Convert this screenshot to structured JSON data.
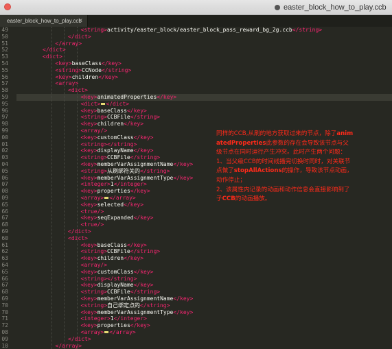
{
  "window": {
    "title": "easter_block_how_to_play.ccb",
    "document_icon": "document-proxy-icon"
  },
  "tab": {
    "label": "easter_block_how_to_play.ccb",
    "close_glyph": "×"
  },
  "colors": {
    "background": "#272822",
    "tag": "#f92672",
    "text": "#f8f8f2",
    "annotation": "#ff2a1a"
  },
  "lines": [
    {
      "num": "49",
      "indent": 6,
      "segs": [
        [
          "tag",
          "<string>"
        ],
        [
          "txt",
          "activity/easter_block/easter_block_pass_reward_bg_2g.ccb"
        ],
        [
          "tag",
          "</string>"
        ]
      ]
    },
    {
      "num": "50",
      "indent": 5,
      "segs": [
        [
          "tag",
          "</dict>"
        ]
      ]
    },
    {
      "num": "51",
      "indent": 4,
      "segs": [
        [
          "tag",
          "</array>"
        ]
      ]
    },
    {
      "num": "52",
      "indent": 3,
      "segs": [
        [
          "tag",
          "</dict>"
        ]
      ]
    },
    {
      "num": "53",
      "indent": 3,
      "segs": [
        [
          "tag",
          "<dict>"
        ]
      ]
    },
    {
      "num": "54",
      "indent": 4,
      "segs": [
        [
          "tag",
          "<key>"
        ],
        [
          "txt",
          "baseClass"
        ],
        [
          "tag",
          "</key>"
        ]
      ]
    },
    {
      "num": "55",
      "indent": 4,
      "segs": [
        [
          "tag",
          "<string>"
        ],
        [
          "txt",
          "CCNode"
        ],
        [
          "tag",
          "</string>"
        ]
      ]
    },
    {
      "num": "56",
      "indent": 4,
      "segs": [
        [
          "tag",
          "<key>"
        ],
        [
          "txt",
          "children"
        ],
        [
          "tag",
          "</key>"
        ]
      ]
    },
    {
      "num": "57",
      "indent": 4,
      "segs": [
        [
          "tag",
          "<array>"
        ]
      ]
    },
    {
      "num": "58",
      "indent": 5,
      "segs": [
        [
          "tag",
          "<dict>"
        ]
      ]
    },
    {
      "num": "59",
      "indent": 6,
      "segs": [
        [
          "tag",
          "<key>"
        ],
        [
          "txt",
          "animatedProperties"
        ],
        [
          "tag",
          "</key>"
        ]
      ]
    },
    {
      "num": "95",
      "indent": 6,
      "segs": [
        [
          "tag",
          "<dict>"
        ],
        [
          "mark",
          ""
        ],
        [
          "tag",
          "</dict>"
        ]
      ]
    },
    {
      "num": "96",
      "indent": 6,
      "segs": [
        [
          "tag",
          "<key>"
        ],
        [
          "txt",
          "baseClass"
        ],
        [
          "tag",
          "</key>"
        ]
      ]
    },
    {
      "num": "97",
      "indent": 6,
      "segs": [
        [
          "tag",
          "<string>"
        ],
        [
          "txt",
          "CCBFile"
        ],
        [
          "tag",
          "</string>"
        ]
      ]
    },
    {
      "num": "98",
      "indent": 6,
      "segs": [
        [
          "tag",
          "<key>"
        ],
        [
          "txt",
          "children"
        ],
        [
          "tag",
          "</key>"
        ]
      ]
    },
    {
      "num": "99",
      "indent": 6,
      "segs": [
        [
          "tag",
          "<array/>"
        ]
      ]
    },
    {
      "num": "00",
      "indent": 6,
      "segs": [
        [
          "tag",
          "<key>"
        ],
        [
          "txt",
          "customClass"
        ],
        [
          "tag",
          "</key>"
        ]
      ]
    },
    {
      "num": "01",
      "indent": 6,
      "segs": [
        [
          "tag",
          "<string>"
        ],
        [
          "tag",
          "</string>"
        ]
      ]
    },
    {
      "num": "02",
      "indent": 6,
      "segs": [
        [
          "tag",
          "<key>"
        ],
        [
          "txt",
          "displayName"
        ],
        [
          "tag",
          "</key>"
        ]
      ]
    },
    {
      "num": "03",
      "indent": 6,
      "segs": [
        [
          "tag",
          "<string>"
        ],
        [
          "txt",
          "CCBFile"
        ],
        [
          "tag",
          "</string>"
        ]
      ]
    },
    {
      "num": "04",
      "indent": 6,
      "segs": [
        [
          "tag",
          "<key>"
        ],
        [
          "txt",
          "memberVarAssignmentName"
        ],
        [
          "tag",
          "</key>"
        ]
      ]
    },
    {
      "num": "05",
      "indent": 6,
      "segs": [
        [
          "tag",
          "<string>"
        ],
        [
          "txt",
          "从刷绑符关的"
        ],
        [
          "tag",
          "</string>"
        ]
      ]
    },
    {
      "num": "06",
      "indent": 6,
      "segs": [
        [
          "tag",
          "<key>"
        ],
        [
          "txt",
          "memberVarAssignmentType"
        ],
        [
          "tag",
          "</key>"
        ]
      ]
    },
    {
      "num": "07",
      "indent": 6,
      "segs": [
        [
          "tag",
          "<integer>"
        ],
        [
          "txt",
          "1"
        ],
        [
          "tag",
          "</integer>"
        ]
      ]
    },
    {
      "num": "08",
      "indent": 6,
      "segs": [
        [
          "tag",
          "<key>"
        ],
        [
          "txt",
          "properties"
        ],
        [
          "tag",
          "</key>"
        ]
      ]
    },
    {
      "num": "09",
      "indent": 6,
      "segs": [
        [
          "tag",
          "<array>"
        ],
        [
          "mark",
          ""
        ],
        [
          "tag",
          "</array>"
        ]
      ]
    },
    {
      "num": "65",
      "indent": 6,
      "segs": [
        [
          "tag",
          "<key>"
        ],
        [
          "txt",
          "selected"
        ],
        [
          "tag",
          "</key>"
        ]
      ]
    },
    {
      "num": "66",
      "indent": 6,
      "segs": [
        [
          "tag",
          "<true/>"
        ]
      ]
    },
    {
      "num": "67",
      "indent": 6,
      "segs": [
        [
          "tag",
          "<key>"
        ],
        [
          "txt",
          "seqExpanded"
        ],
        [
          "tag",
          "</key>"
        ]
      ]
    },
    {
      "num": "68",
      "indent": 6,
      "segs": [
        [
          "tag",
          "<true/>"
        ]
      ]
    },
    {
      "num": "69",
      "indent": 5,
      "segs": [
        [
          "tag",
          "</dict>"
        ]
      ]
    },
    {
      "num": "60",
      "indent": 5,
      "segs": [
        [
          "tag",
          "<dict>"
        ]
      ]
    },
    {
      "num": "61",
      "indent": 6,
      "segs": [
        [
          "tag",
          "<key>"
        ],
        [
          "txt",
          "baseClass"
        ],
        [
          "tag",
          "</key>"
        ]
      ]
    },
    {
      "num": "62",
      "indent": 6,
      "segs": [
        [
          "tag",
          "<string>"
        ],
        [
          "txt",
          "CCBFile"
        ],
        [
          "tag",
          "</string>"
        ]
      ]
    },
    {
      "num": "63",
      "indent": 6,
      "segs": [
        [
          "tag",
          "<key>"
        ],
        [
          "txt",
          "children"
        ],
        [
          "tag",
          "</key>"
        ]
      ]
    },
    {
      "num": "64",
      "indent": 6,
      "segs": [
        [
          "tag",
          "<array/>"
        ]
      ]
    },
    {
      "num": "65",
      "indent": 6,
      "segs": [
        [
          "tag",
          "<key>"
        ],
        [
          "txt",
          "customClass"
        ],
        [
          "tag",
          "</key>"
        ]
      ]
    },
    {
      "num": "66",
      "indent": 6,
      "segs": [
        [
          "tag",
          "<string>"
        ],
        [
          "tag",
          "</string>"
        ]
      ]
    },
    {
      "num": "67",
      "indent": 6,
      "segs": [
        [
          "tag",
          "<key>"
        ],
        [
          "txt",
          "displayName"
        ],
        [
          "tag",
          "</key>"
        ]
      ]
    },
    {
      "num": "68",
      "indent": 6,
      "segs": [
        [
          "tag",
          "<string>"
        ],
        [
          "txt",
          "CCBFile"
        ],
        [
          "tag",
          "</string>"
        ]
      ]
    },
    {
      "num": "69",
      "indent": 6,
      "segs": [
        [
          "tag",
          "<key>"
        ],
        [
          "txt",
          "memberVarAssignmentName"
        ],
        [
          "tag",
          "</key>"
        ]
      ]
    },
    {
      "num": "70",
      "indent": 6,
      "segs": [
        [
          "tag",
          "<string>"
        ],
        [
          "txt",
          "自己绑定点的"
        ],
        [
          "tag",
          "</string>"
        ]
      ]
    },
    {
      "num": "70",
      "indent": 6,
      "segs": [
        [
          "tag",
          "<key>"
        ],
        [
          "txt",
          "memberVarAssignmentType"
        ],
        [
          "tag",
          "</key>"
        ]
      ]
    },
    {
      "num": "71",
      "indent": 6,
      "segs": [
        [
          "tag",
          "<integer>"
        ],
        [
          "txt",
          "1"
        ],
        [
          "tag",
          "</integer>"
        ]
      ]
    },
    {
      "num": "72",
      "indent": 6,
      "segs": [
        [
          "tag",
          "<key>"
        ],
        [
          "txt",
          "properties"
        ],
        [
          "tag",
          "</key>"
        ]
      ]
    },
    {
      "num": "08",
      "indent": 6,
      "segs": [
        [
          "tag",
          "<array>"
        ],
        [
          "mark",
          ""
        ],
        [
          "tag",
          "</array>"
        ]
      ]
    },
    {
      "num": "09",
      "indent": 5,
      "segs": [
        [
          "tag",
          "</dict>"
        ]
      ]
    },
    {
      "num": "10",
      "indent": 4,
      "segs": [
        [
          "tag",
          "</array>"
        ]
      ]
    }
  ],
  "annotation": {
    "paragraphs": [
      [
        [
          "n",
          "同样的CCB,从刷的地方获取过来的节点，除了"
        ],
        [
          "b",
          "animatedProperties"
        ],
        [
          "n",
          "此参数的存在会导致该节点与父级节点在同时运行产生冲突。此时产生两个问题："
        ]
      ],
      [
        [
          "n",
          "1、当父级CCB的时间线播完切换时同时，对关联节点做了"
        ],
        [
          "b",
          "stopAllActions"
        ],
        [
          "n",
          "的操作，导致该节点动画，动作停止；"
        ]
      ],
      [
        [
          "n",
          "2、该属性内记录的动画和动作信息会直接影响到了子"
        ],
        [
          "b",
          "CCB"
        ],
        [
          "n",
          "的动画播放。"
        ]
      ]
    ]
  }
}
